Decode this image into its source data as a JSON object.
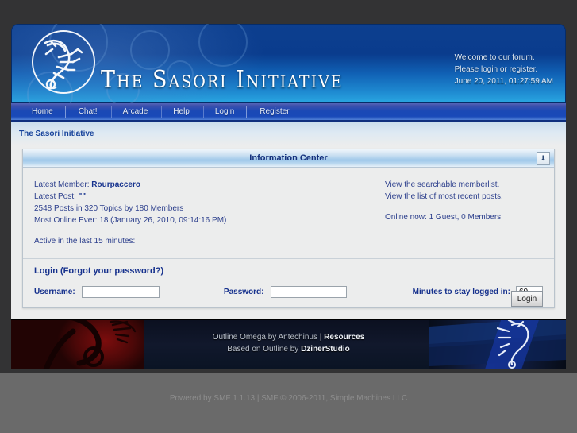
{
  "site": {
    "logo_text": "The Sasori Initiative",
    "logo_icon": "scorpion-roundel-icon"
  },
  "header": {
    "welcome_line1": "Welcome to our forum.",
    "welcome_line2": "Please login or register.",
    "datetime": "June 20, 2011, 01:27:59 AM"
  },
  "nav": {
    "items": [
      {
        "label": "Home"
      },
      {
        "label": "Chat!"
      },
      {
        "label": "Arcade"
      },
      {
        "label": "Help"
      },
      {
        "label": "Login"
      },
      {
        "label": "Register"
      }
    ]
  },
  "breadcrumb": {
    "text": "The Sasori Initiative"
  },
  "info_center": {
    "title": "Information Center",
    "collapse_icon": "⬇",
    "stats_left": {
      "latest_member_label": "Latest Member:",
      "latest_member_name": "Rourpaccero",
      "latest_post_label": "Latest Post:",
      "latest_post_value": "\"\"",
      "totals": "2548 Posts in 320 Topics by 180 Members",
      "most_online": "Most Online Ever: 18 (January 26, 2010, 09:14:16 PM)",
      "active_line": "Active in the last 15 minutes:"
    },
    "stats_right": {
      "memberlist_link": "View the searchable memberlist.",
      "recent_posts_link": "View the list of most recent posts.",
      "online_now": "Online now: 1 Guest, 0 Members"
    }
  },
  "login": {
    "heading": "Login",
    "forgot_link": "(Forgot your password?)",
    "username_label": "Username:",
    "username_value": "",
    "password_label": "Password:",
    "password_value": "",
    "minutes_label": "Minutes to stay logged in:",
    "minutes_value": "60",
    "submit_label": "Login"
  },
  "footer": {
    "credit_line1_a": "Outline Omega by Antechinus | ",
    "credit_line1_b": "Resources",
    "credit_line2_a": "Based on Outline by ",
    "credit_line2_b": "DzinerStudio",
    "left_art": "red-scorpion-banner",
    "right_art": "blue-scorpion-banner"
  },
  "copyright": {
    "smf_version": "Powered by SMF 1.1.13",
    "separator": " | ",
    "smf_copy": "SMF © 2006-2011, Simple Machines LLC"
  },
  "colors": {
    "header_blue": "#0d3f8f",
    "nav_blue": "#1949b8",
    "link_blue": "#2b3e8c",
    "content_bg": "#eceded",
    "page_bg": "#333334"
  }
}
